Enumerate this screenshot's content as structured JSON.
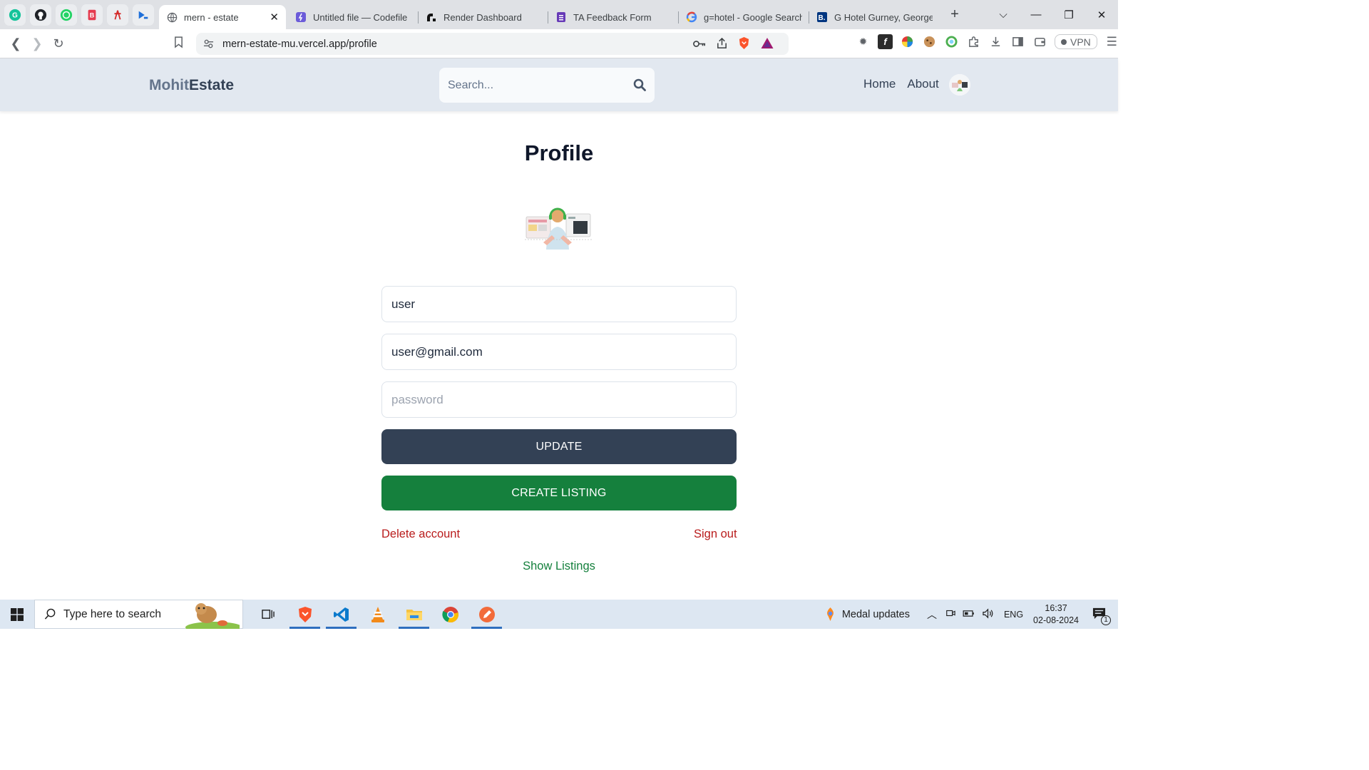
{
  "browser": {
    "tabs": [
      {
        "title": "mern - estate",
        "active": true
      },
      {
        "title": "Untitled file — Codefile",
        "active": false
      },
      {
        "title": "Render Dashboard",
        "active": false
      },
      {
        "title": "TA Feedback Form",
        "active": false
      },
      {
        "title": "g=hotel - Google Search",
        "active": false
      },
      {
        "title": "G Hotel Gurney, George",
        "active": false
      }
    ],
    "url": "mern-estate-mu.vercel.app/profile",
    "vpn_label": "VPN"
  },
  "header": {
    "logo_part1": "Mohit",
    "logo_part2": "Estate",
    "search_placeholder": "Search...",
    "nav": {
      "home": "Home",
      "about": "About"
    }
  },
  "profile": {
    "title": "Profile",
    "username": "user",
    "email": "user@gmail.com",
    "password_placeholder": "password",
    "update_label": "UPDATE",
    "create_listing_label": "CREATE LISTING",
    "delete_account_label": "Delete account",
    "sign_out_label": "Sign out",
    "show_listings_label": "Show Listings"
  },
  "colors": {
    "header_bg": "#e2e8f0",
    "update_btn": "#334155",
    "create_btn": "#15803d",
    "danger_text": "#b91c1c",
    "success_text": "#15803d"
  },
  "taskbar": {
    "search_placeholder": "Type here to search",
    "notification_text": "Medal updates",
    "language": "ENG",
    "time": "16:37",
    "date": "02-08-2024",
    "notification_count": "1"
  }
}
